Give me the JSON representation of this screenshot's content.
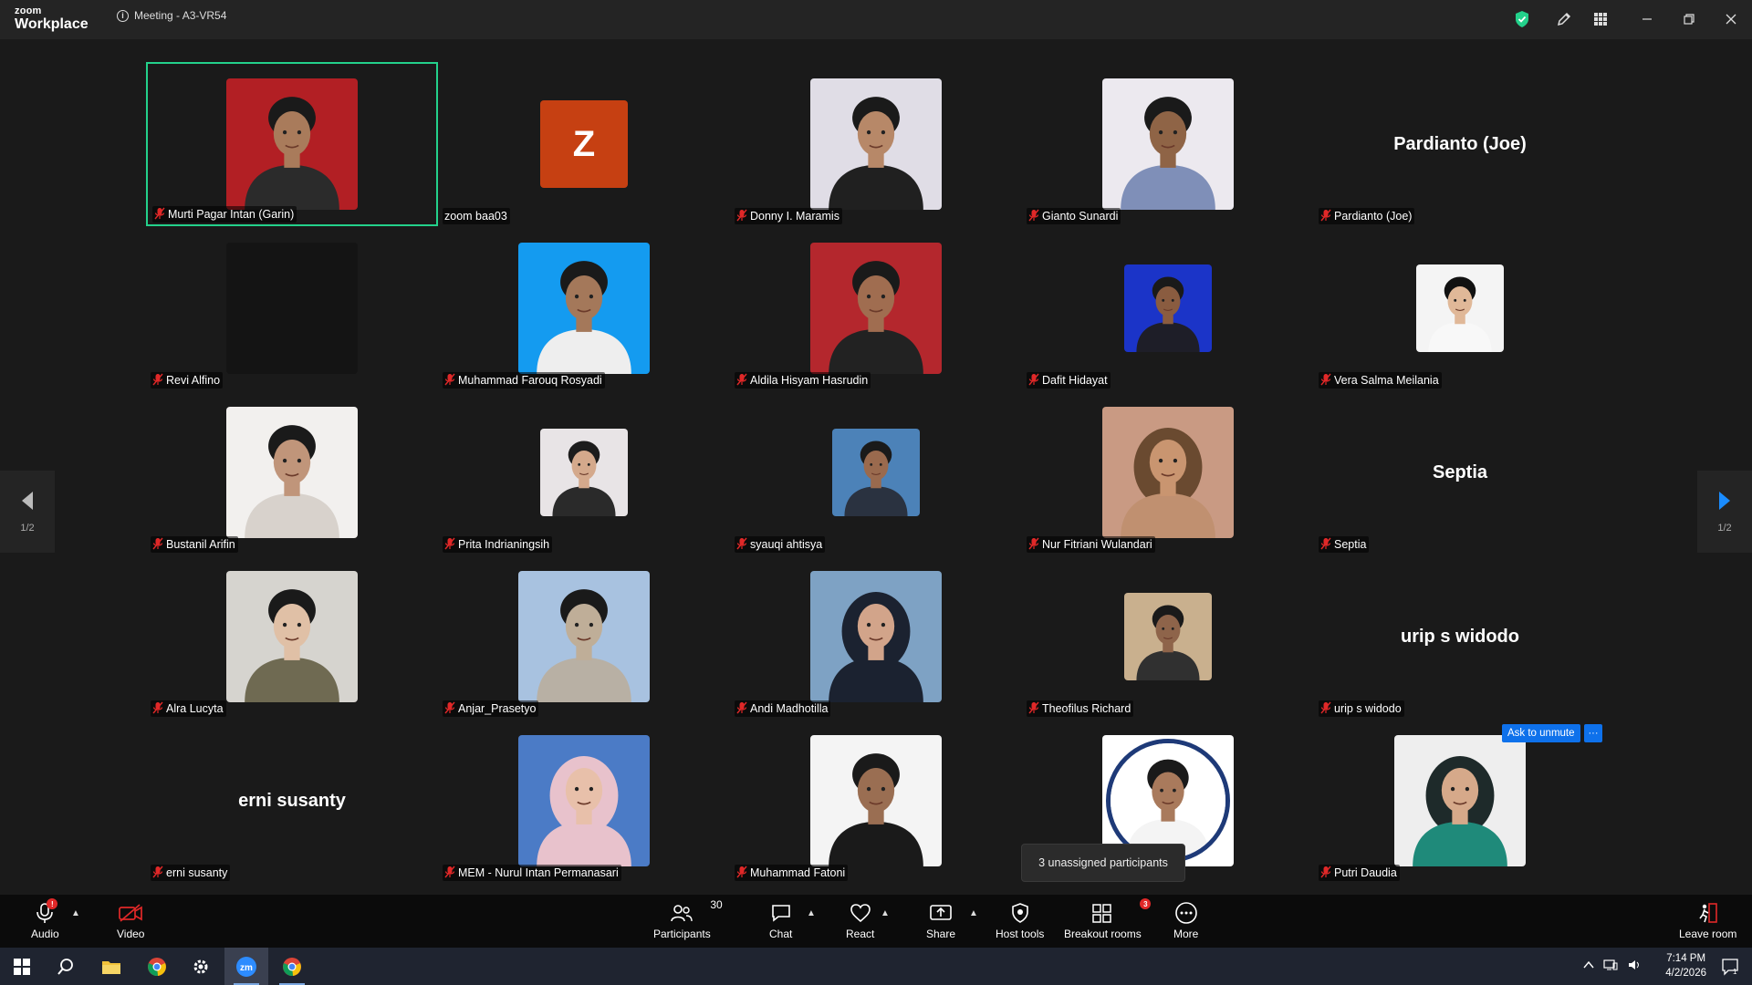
{
  "titlebar": {
    "brand_top": "zoom",
    "brand_bottom": "Workplace",
    "meeting_title": "Meeting - A3-VR54"
  },
  "participants": [
    {
      "name": "Murti Pagar Intan (Garin)",
      "muted": true,
      "tile": "photo",
      "bg": "#b21f24",
      "skin": "#a97b5b",
      "shirt": "#2b2b2b",
      "active": true
    },
    {
      "name": "zoom baa03",
      "muted": false,
      "tile": "avatar",
      "initial": "Z",
      "bg": "#c64012"
    },
    {
      "name": "Donny I. Maramis",
      "muted": true,
      "tile": "photo",
      "bg": "#e0dde6",
      "skin": "#b78868",
      "shirt": "#202020"
    },
    {
      "name": "Gianto Sunardi",
      "muted": true,
      "tile": "photo",
      "bg": "#ece9ef",
      "skin": "#8f6446",
      "shirt": "#7f8fb8"
    },
    {
      "name": "Pardianto (Joe)",
      "muted": true,
      "tile": "name",
      "display_name": "Pardianto (Joe)"
    },
    {
      "name": "Revi Alfino",
      "muted": true,
      "tile": "dark",
      "bg": "#141414"
    },
    {
      "name": "Muhammad Farouq Rosyadi",
      "muted": true,
      "tile": "photo",
      "bg": "#149bf0",
      "skin": "#a4785a",
      "shirt": "#eeeeee"
    },
    {
      "name": "Aldila Hisyam Hasrudin",
      "muted": true,
      "tile": "photo",
      "bg": "#b4272d",
      "skin": "#a06d50",
      "shirt": "#222222"
    },
    {
      "name": "Dafit Hidayat",
      "muted": true,
      "tile": "photo-small",
      "bg": "#1b34c8",
      "skin": "#8a5c40",
      "shirt": "#1e1e28"
    },
    {
      "name": "Vera Salma Meilania",
      "muted": true,
      "tile": "photo-small",
      "bg": "#f4f4f4",
      "skin": "#e0b898",
      "shirt": "#f8f8f8",
      "hair": "#111111"
    },
    {
      "name": "Bustanil Arifin",
      "muted": true,
      "tile": "photo",
      "bg": "#f2f0ee",
      "skin": "#c0957a",
      "shirt": "#d8d2cc"
    },
    {
      "name": "Prita Indrianingsih",
      "muted": true,
      "tile": "photo-small",
      "bg": "#e8e4e6",
      "skin": "#d4a98c",
      "shirt": "#2a2a2a",
      "hair": "#1c1c1c"
    },
    {
      "name": "syauqi ahtisya",
      "muted": true,
      "tile": "photo-small",
      "bg": "#4c82b8",
      "skin": "#9a6a4e",
      "shirt": "#2a3240"
    },
    {
      "name": "Nur Fitriani Wulandari",
      "muted": true,
      "tile": "photo",
      "bg": "#c99a83",
      "skin": "#c99570",
      "shirt": "#c09070",
      "hair": "#6a4a30"
    },
    {
      "name": "Septia",
      "muted": true,
      "tile": "name",
      "display_name": "Septia"
    },
    {
      "name": "Alra Lucyta",
      "muted": true,
      "tile": "photo",
      "bg": "#d6d4cf",
      "skin": "#e0c0a6",
      "shirt": "#6f6a52",
      "hair": "#1a1a1a"
    },
    {
      "name": "Anjar_Prasetyo",
      "muted": true,
      "tile": "photo",
      "bg": "#a8c2e0",
      "skin": "#bfae98",
      "shirt": "#b8b0a4"
    },
    {
      "name": "Andi Madhotilla",
      "muted": true,
      "tile": "photo",
      "bg": "#7ea2c4",
      "skin": "#d2a48a",
      "shirt": "#1b2230",
      "hair": "#1b2230"
    },
    {
      "name": "Theofilus Richard",
      "muted": true,
      "tile": "photo-small",
      "bg": "#c9b08e",
      "skin": "#8e644a",
      "shirt": "#303030"
    },
    {
      "name": "urip s widodo",
      "muted": true,
      "tile": "name",
      "display_name": "urip s widodo"
    },
    {
      "name": "erni susanty",
      "muted": true,
      "tile": "name",
      "display_name": "erni susanty"
    },
    {
      "name": "MEM - Nurul Intan Permanasari",
      "muted": true,
      "tile": "photo",
      "bg": "#4b7bc6",
      "skin": "#e8c0aa",
      "shirt": "#e8c2cc",
      "hair": "#e8c2cc"
    },
    {
      "name": "Muhammad Fatoni",
      "muted": true,
      "tile": "photo",
      "bg": "#f4f4f4",
      "skin": "#9a6e52",
      "shirt": "#1a1a1a"
    },
    {
      "name": "",
      "muted": false,
      "tile": "photo-round",
      "bg": "#ffffff",
      "skin": "#a97a5c",
      "shirt": "#f4f4f4",
      "ring": "#1e3a78"
    },
    {
      "name": "Putri Daudia",
      "muted": true,
      "tile": "photo",
      "bg": "#eeeeee",
      "skin": "#d6a98a",
      "shirt": "#1f8a7a",
      "hair": "#1e2a2a"
    }
  ],
  "pagination": {
    "prev_label": "1/2",
    "next_label": "1/2"
  },
  "ask_unmute": {
    "label": "Ask to unmute",
    "more": "···"
  },
  "tooltip": {
    "text": "3 unassigned participants"
  },
  "toolbar": {
    "audio": "Audio",
    "video": "Video",
    "participants": "Participants",
    "participants_count": "30",
    "chat": "Chat",
    "react": "React",
    "share": "Share",
    "host_tools": "Host tools",
    "breakout_rooms": "Breakout rooms",
    "breakout_badge": "3",
    "more": "More",
    "leave": "Leave room",
    "audio_badge": "!"
  },
  "taskbar": {
    "time": "7:14 PM",
    "date": "4/2/2026",
    "notification_count": "1"
  },
  "colors": {
    "accent": "#0e71eb",
    "active_speaker": "#23d18b",
    "muted_red": "#e02828"
  }
}
